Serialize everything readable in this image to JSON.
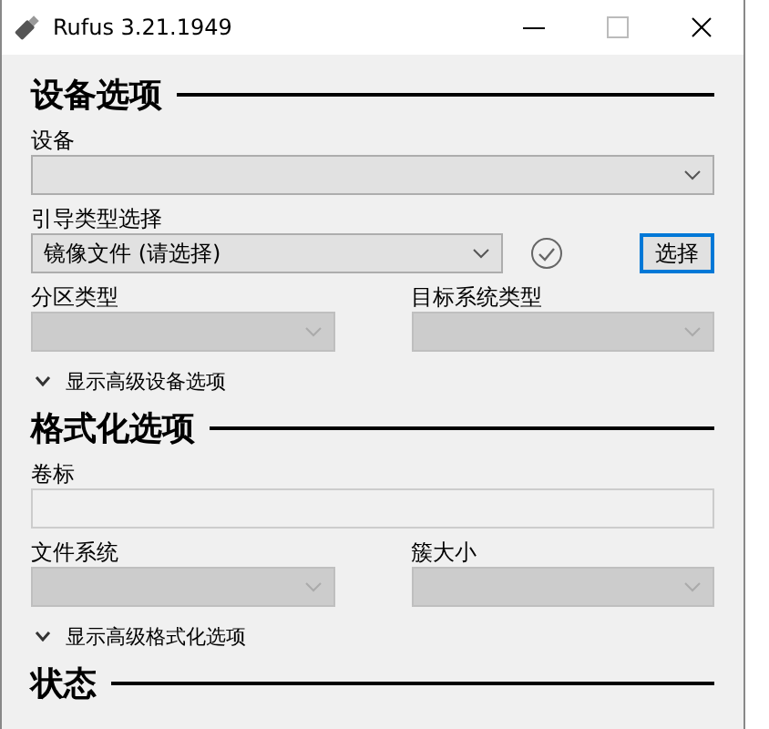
{
  "window": {
    "title": "Rufus 3.21.1949"
  },
  "sections": [
    {
      "heading": "设备选项",
      "rows": [
        {
          "kind": "full",
          "fields": [
            {
              "label": "设备",
              "kind": "dropdown",
              "disabled": false
            }
          ]
        },
        {
          "kind": "boot",
          "fields": [
            {
              "label": "引导类型选择",
              "kind": "dropdown",
              "value": "镜像文件 (请选择)",
              "disabled": false
            }
          ],
          "button": {
            "label": "选择",
            "focused": true
          }
        },
        {
          "kind": "half",
          "fields": [
            {
              "label": "分区类型",
              "kind": "dropdown",
              "disabled": true
            },
            {
              "label": "目标系统类型",
              "kind": "dropdown",
              "disabled": true
            }
          ]
        }
      ],
      "expander": {
        "label": "显示高级设备选项",
        "expanded": false
      }
    },
    {
      "heading": "格式化选项",
      "rows": [
        {
          "kind": "full",
          "fields": [
            {
              "label": "卷标",
              "kind": "text",
              "disabled": false
            }
          ]
        },
        {
          "kind": "half",
          "fields": [
            {
              "label": "文件系统",
              "kind": "dropdown",
              "disabled": true
            },
            {
              "label": "簇大小",
              "kind": "dropdown",
              "disabled": true
            }
          ]
        }
      ],
      "expander": {
        "label": "显示高级格式化选项",
        "expanded": false
      }
    },
    {
      "heading": "状态"
    }
  ]
}
